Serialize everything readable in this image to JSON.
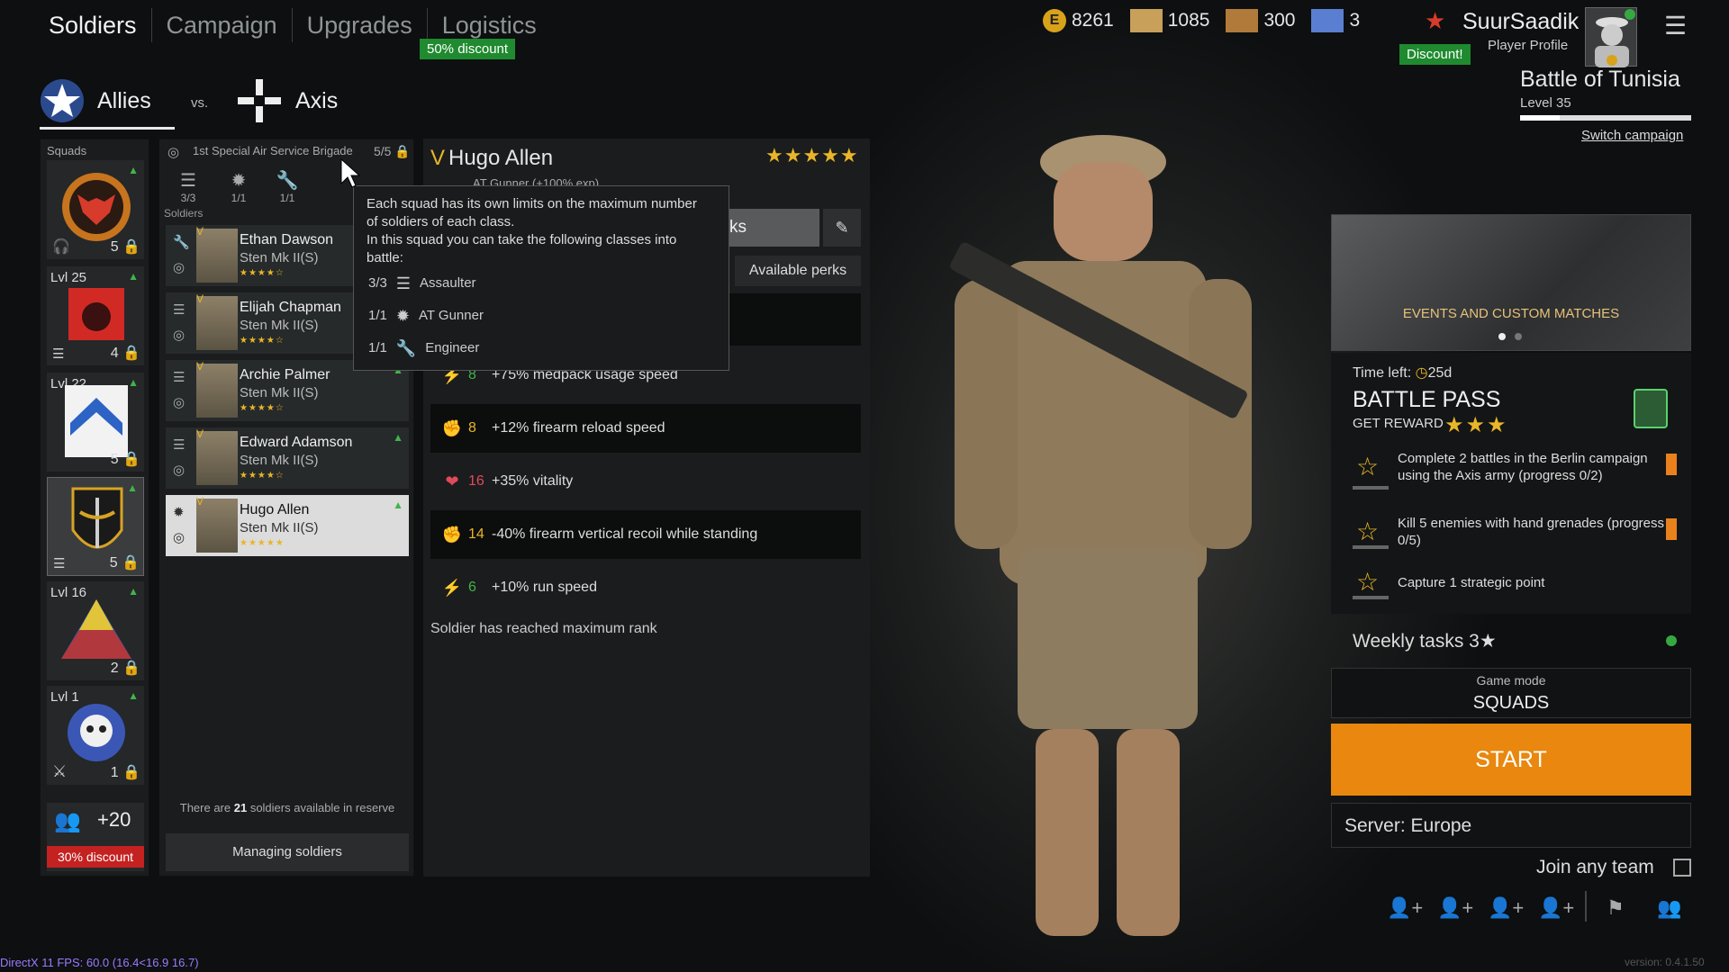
{
  "nav": {
    "tabs": [
      "Soldiers",
      "Campaign",
      "Upgrades",
      "Logistics"
    ],
    "logistics_discount": "50% discount"
  },
  "faction": {
    "allies": "Allies",
    "vs": "vs.",
    "axis": "Axis"
  },
  "squads": {
    "label": "Squads",
    "items": [
      {
        "level": "",
        "count": "5"
      },
      {
        "level": "Lvl 25",
        "count": "4"
      },
      {
        "level": "Lvl 22",
        "count": "5"
      },
      {
        "level": "",
        "count": "5"
      },
      {
        "level": "Lvl 16",
        "count": "2"
      },
      {
        "level": "Lvl 1",
        "count": "1"
      }
    ],
    "reserve_plus": "+20",
    "reserve_discount": "30% discount"
  },
  "squad": {
    "brigade": "1st Special Air Service Brigade",
    "count": "5/5",
    "class_limits": [
      "3/3",
      "1/1",
      "1/1"
    ],
    "soldiers_label": "Soldiers",
    "soldiers": [
      {
        "rank": "V",
        "name": "Ethan Dawson",
        "weapon": "Sten Mk II(S)",
        "stars": "★★★★☆"
      },
      {
        "rank": "V",
        "name": "Elijah Chapman",
        "weapon": "Sten Mk II(S)",
        "stars": "★★★★☆"
      },
      {
        "rank": "V",
        "name": "Archie Palmer",
        "weapon": "Sten Mk II(S)",
        "stars": "★★★★☆"
      },
      {
        "rank": "V",
        "name": "Edward Adamson",
        "weapon": "Sten Mk II(S)",
        "stars": "★★★★☆"
      },
      {
        "rank": "V",
        "name": "Hugo Allen",
        "weapon": "Sten Mk II(S)",
        "stars": "★★★★★"
      }
    ],
    "reserve_pre": "There are ",
    "reserve_num": "21",
    "reserve_post": " soldiers available in reserve",
    "manage": "Managing soldiers"
  },
  "detail": {
    "rank": "V",
    "name": "Hugo Allen",
    "stars": "★★★★★",
    "class_line": "AT Gunner (+100% exp)",
    "perks_tab": "ks",
    "available_perks": "Available perks",
    "perks": [
      {
        "icon": "⚡",
        "value": "8",
        "desc": "+75% medpack usage speed",
        "color": "#3fb54a"
      },
      {
        "icon": "✊",
        "value": "8",
        "desc": "+12% firearm reload speed",
        "color": "#e8b628"
      },
      {
        "icon": "❤",
        "value": "16",
        "desc": "+35% vitality",
        "color": "#e04a5a"
      },
      {
        "icon": "✊",
        "value": "14",
        "desc": "-40% firearm vertical recoil while standing",
        "color": "#e8b628"
      },
      {
        "icon": "⚡",
        "value": "6",
        "desc": "+10% run speed",
        "color": "#3fb54a"
      }
    ],
    "max_rank": "Soldier has reached maximum rank"
  },
  "tooltip": {
    "line1": "Each squad has its own limits on the maximum number",
    "line2": "of soldiers of each class.",
    "line3": "In this squad you can take the following classes into",
    "line4": "battle:",
    "rows": [
      {
        "limit": "3/3",
        "cls": "Assaulter"
      },
      {
        "limit": "1/1",
        "cls": "AT Gunner"
      },
      {
        "limit": "1/1",
        "cls": "Engineer"
      }
    ]
  },
  "resources": [
    {
      "icon": "E",
      "value": "8261",
      "color": "#d9a21b"
    },
    {
      "icon": "✉",
      "value": "1085",
      "color": "#c8a05a"
    },
    {
      "icon": "✉",
      "value": "300",
      "color": "#b07a3a"
    },
    {
      "icon": "✉",
      "value": "3",
      "color": "#5a7fd0"
    }
  ],
  "profile": {
    "name": "SuurSaadik",
    "sub": "Player Profile",
    "discount": "Discount!"
  },
  "campaign": {
    "title": "Battle of Tunisia",
    "level": "Level 35",
    "progress": 0.23,
    "switch": "Switch campaign"
  },
  "events": {
    "label": "EVENTS AND CUSTOM MATCHES"
  },
  "battlepass": {
    "time_label": "Time left:",
    "time_value": "25d",
    "title": "BATTLE PASS",
    "reward": "GET REWARD",
    "reward_stars": "★★★",
    "tasks": [
      {
        "text": "Complete 2 battles in the Berlin campaign using the Axis army (progress 0/2)"
      },
      {
        "text": "Kill 5 enemies with hand grenades (progress 0/5)"
      },
      {
        "text": "Capture 1 strategic point"
      }
    ],
    "weekly": "Weekly tasks 3★"
  },
  "game_mode": {
    "label": "Game mode",
    "value": "SQUADS"
  },
  "start": "START",
  "server": "Server: Europe",
  "join_any": "Join any team",
  "fps": "DirectX 11 FPS: 60.0 (16.4<16.9 16.7)",
  "version": "version: 0.4.1.50"
}
